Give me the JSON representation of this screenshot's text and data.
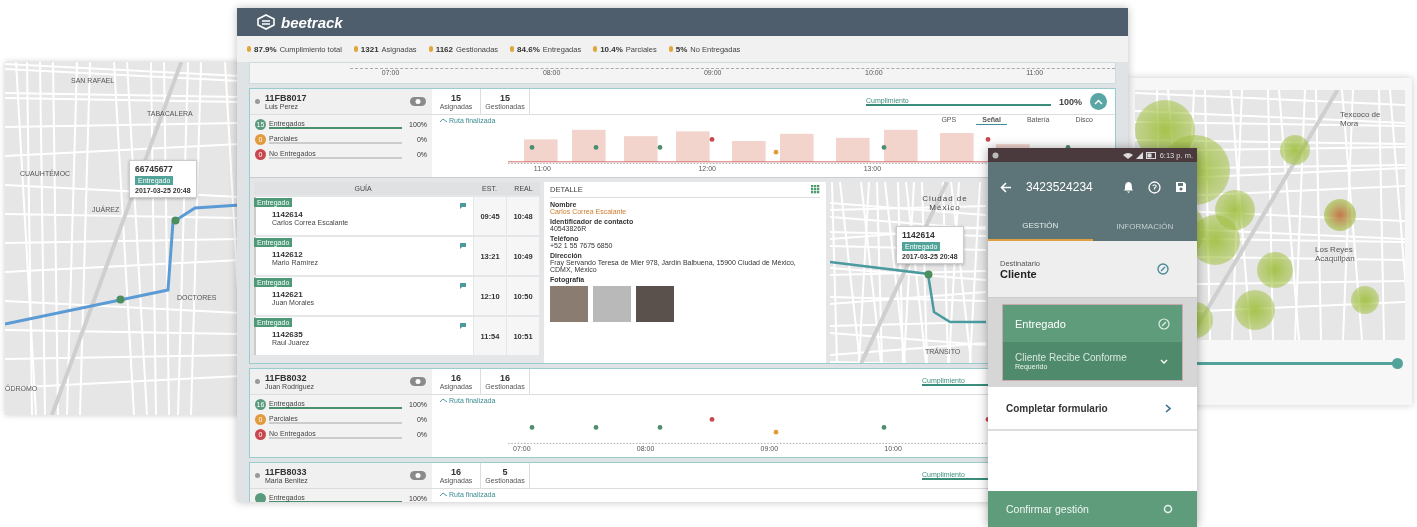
{
  "left_map": {
    "area_labels": [
      "SAN RAFAEL",
      "TABACALERA",
      "CUAUHTÉMOC",
      "JUÁREZ",
      "DOCTORES",
      "ÓDROMO"
    ],
    "popup": {
      "id": "66745677",
      "status": "Entregado",
      "date": "2017-03-25 20:48"
    }
  },
  "heatmap": {
    "labels": [
      "Texcoco de Mora",
      "Los Reyes Acaquilpan"
    ],
    "slider": {
      "level": 1
    }
  },
  "dashboard": {
    "brand": "beetrack",
    "stats": [
      {
        "value": "87.9%",
        "label": "Cumplimiento total"
      },
      {
        "value": "1321",
        "label": "Asignadas"
      },
      {
        "value": "1162",
        "label": "Gestionadas"
      },
      {
        "value": "84.6%",
        "label": "Entregadas"
      },
      {
        "value": "10.4%",
        "label": "Parciales"
      },
      {
        "value": "5%",
        "label": "No Entregadas"
      }
    ],
    "top_axis": [
      "07:00",
      "08:00",
      "09:00",
      "10:00",
      "11:00"
    ],
    "routes": [
      {
        "id": "11FB8017",
        "driver": "Luis Perez",
        "assigned": "15",
        "assigned_label": "Asignadas",
        "managed": "15",
        "managed_label": "Gestionadas",
        "compliance": {
          "label": "Cumplimiento",
          "level": 1,
          "reading": "100%"
        },
        "expanded": true,
        "legend": [
          {
            "count": "15",
            "label": "Entregados",
            "level": 1,
            "reading": "100%",
            "color": "#5a9a7e"
          },
          {
            "count": "0",
            "label": "Parciales",
            "level": 0,
            "reading": "0%",
            "color": "#e39a3a"
          },
          {
            "count": "0",
            "label": "No Entregados",
            "level": 0,
            "reading": "0%",
            "color": "#c9484f"
          }
        ],
        "route_status": "Ruta finalizada",
        "filters": [
          {
            "label": "GPS",
            "selected": false
          },
          {
            "label": "Señal",
            "selected": true
          },
          {
            "label": "Batería",
            "selected": false
          },
          {
            "label": "Disco",
            "selected": false
          }
        ],
        "axis": [
          "11:00",
          "12:00",
          "13:00"
        ],
        "guides": {
          "headers": [
            "GUÍA",
            "EST.",
            "REAL"
          ],
          "rows": [
            {
              "status": "Entregado",
              "id": "1142614",
              "name": "Carlos Correa Escalante",
              "est": "09:45",
              "real": "10:48"
            },
            {
              "status": "Entregado",
              "id": "1142612",
              "name": "Mario Ramírez",
              "est": "13:21",
              "real": "10:49"
            },
            {
              "status": "Entregado",
              "id": "1142621",
              "name": "Juan Morales",
              "est": "12:10",
              "real": "10:50"
            },
            {
              "status": "Entregado",
              "id": "1142635",
              "name": "Raul Juarez",
              "est": "11:54",
              "real": "10:51"
            }
          ]
        },
        "detail": {
          "title": "DETALLE",
          "fields": [
            {
              "label": "Nombre",
              "value": "Carlos Correa Escalante",
              "kind": "highlight"
            },
            {
              "label": "Identificador de contacto",
              "value": "40543826R",
              "kind": "plain"
            },
            {
              "label": "Teléfono",
              "value": "+52 1 55 7675 6850",
              "kind": "plain"
            },
            {
              "label": "Dirección",
              "value": "Fray Servando Teresa de Mier 978, Jardín Balbuena, 15900 Ciudad de México, CDMX, México",
              "kind": "plain"
            }
          ],
          "photos_label": "Fotografía"
        },
        "map": {
          "city": "Ciudad de México",
          "area": "TRÁNSITO",
          "popup": {
            "id": "1142614",
            "status": "Entregado",
            "date": "2017-03-25 20:48"
          }
        }
      },
      {
        "id": "11FB8032",
        "driver": "Juan Rodriguez",
        "assigned": "16",
        "assigned_label": "Asignadas",
        "managed": "16",
        "managed_label": "Gestionadas",
        "compliance": {
          "label": "Cumplimiento",
          "level": 1
        },
        "legend": [
          {
            "count": "16",
            "label": "Entregados",
            "level": 1,
            "reading": "100%",
            "color": "#5a9a7e"
          },
          {
            "count": "0",
            "label": "Parciales",
            "level": 0,
            "reading": "0%",
            "color": "#e39a3a"
          },
          {
            "count": "0",
            "label": "No Entregados",
            "level": 0,
            "reading": "0%",
            "color": "#c9484f"
          }
        ],
        "route_status": "Ruta finalizada",
        "axis": [
          "07:00",
          "08:00",
          "09:00",
          "10:00"
        ]
      },
      {
        "id": "11FB8033",
        "driver": "Maria Benitez",
        "assigned": "16",
        "assigned_label": "Asignadas",
        "managed": "5",
        "managed_label": "Gestionadas",
        "compliance": {
          "label": "Cumplimiento",
          "level": 1
        },
        "legend": [
          {
            "label": "Entregados",
            "level": 1,
            "reading": "100%",
            "color": "#5a9a7e"
          }
        ],
        "route_status": "Ruta finalizada"
      }
    ]
  },
  "phone": {
    "time": "6:13 p. m.",
    "title": "3423524234",
    "tabs": [
      {
        "label": "GESTIÓN",
        "selected": true
      },
      {
        "label": "INFORMACIÓN",
        "selected": false
      }
    ],
    "recipient": {
      "label": "Destinatario",
      "value": "Cliente"
    },
    "status": {
      "label": "Entregado",
      "sub": "Cliente Recibe Conforme",
      "hint": "Requerido"
    },
    "form_link": "Completar formulario",
    "confirm": "Confirmar gestión"
  }
}
